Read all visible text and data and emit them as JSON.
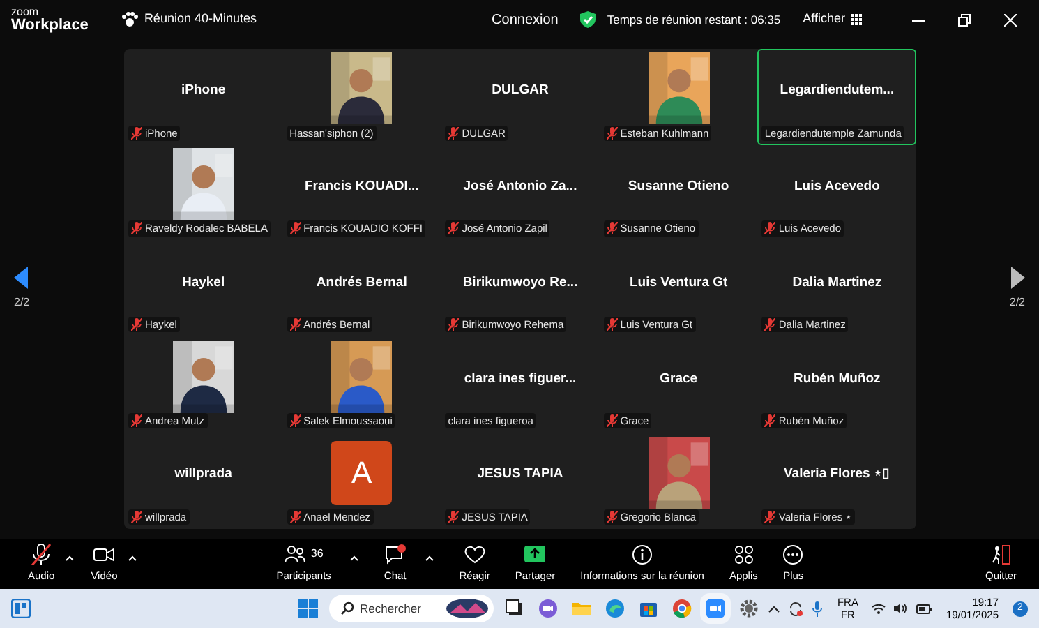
{
  "title_bar": {
    "logo_top": "zoom",
    "logo_bottom": "Workplace",
    "meeting": "Réunion 40-Minutes",
    "signin": "Connexion",
    "timer": "Temps de réunion restant : 06:35",
    "view": "Afficher"
  },
  "pager": {
    "left": "2/2",
    "right": "2/2"
  },
  "tiles": [
    {
      "kind": "name",
      "title": "iPhone",
      "label": "iPhone",
      "muted": true,
      "active": false
    },
    {
      "kind": "video",
      "label": "Hassan'siphon (2)",
      "muted": false,
      "active": false
    },
    {
      "kind": "name",
      "title": "DULGAR",
      "label": "DULGAR",
      "muted": true,
      "active": false
    },
    {
      "kind": "video",
      "label": "Esteban Kuhlmann",
      "muted": true,
      "active": false
    },
    {
      "kind": "name",
      "title": "Legardiendutem...",
      "label": "Legardiendutemple Zamunda",
      "muted": false,
      "active": true
    },
    {
      "kind": "video",
      "label": "Raveldy Rodalec BABELA",
      "muted": true,
      "active": false
    },
    {
      "kind": "name",
      "title": "Francis  KOUADI...",
      "label": "Francis KOUADIO KOFFI",
      "muted": true,
      "active": false
    },
    {
      "kind": "name",
      "title": "José Antonio Za...",
      "label": "José Antonio Zapil",
      "muted": true,
      "active": false
    },
    {
      "kind": "name",
      "title": "Susanne Otieno",
      "label": "Susanne Otieno",
      "muted": true,
      "active": false
    },
    {
      "kind": "name",
      "title": "Luis Acevedo",
      "label": "Luis Acevedo",
      "muted": true,
      "active": false
    },
    {
      "kind": "name",
      "title": "Haykel",
      "label": "Haykel",
      "muted": true,
      "active": false
    },
    {
      "kind": "name",
      "title": "Andrés Bernal",
      "label": "Andrés Bernal",
      "muted": true,
      "active": false
    },
    {
      "kind": "name",
      "title": "Birikumwoyo  Re...",
      "label": "Birikumwoyo Rehema",
      "muted": true,
      "active": false
    },
    {
      "kind": "name",
      "title": "Luis Ventura Gt",
      "label": "Luis Ventura Gt",
      "muted": true,
      "active": false
    },
    {
      "kind": "name",
      "title": "Dalia Martinez",
      "label": "Dalia Martinez",
      "muted": true,
      "active": false
    },
    {
      "kind": "video",
      "label": "Andrea Mutz",
      "muted": true,
      "active": false
    },
    {
      "kind": "video",
      "label": "Salek Elmoussaoui",
      "muted": true,
      "active": false
    },
    {
      "kind": "name",
      "title": "clara ines figuer...",
      "label": "clara ines figueroa",
      "muted": false,
      "active": false
    },
    {
      "kind": "name",
      "title": "Grace",
      "label": "Grace",
      "muted": true,
      "active": false
    },
    {
      "kind": "name",
      "title": "Rubén Muñoz",
      "label": "Rubén Muñoz",
      "muted": true,
      "active": false
    },
    {
      "kind": "name",
      "title": "willprada",
      "label": "willprada",
      "muted": true,
      "active": false
    },
    {
      "kind": "avatar",
      "letter": "A",
      "label": "Anael Mendez",
      "muted": true,
      "active": false
    },
    {
      "kind": "name",
      "title": "JESUS TAPIA",
      "label": "JESUS TAPIA",
      "muted": true,
      "active": false
    },
    {
      "kind": "video",
      "label": "Gregorio Blanca",
      "muted": true,
      "active": false
    },
    {
      "kind": "name",
      "title": "Valeria  Flores  ⋆▯",
      "label": "Valeria Flores ⋆",
      "muted": true,
      "active": false
    }
  ],
  "toolbar": {
    "left": [
      {
        "kind": "audio",
        "label": "Audio"
      },
      {
        "kind": "video",
        "label": "Vidéo"
      }
    ],
    "center": [
      {
        "kind": "participants",
        "label": "Participants",
        "count": "36"
      },
      {
        "kind": "chat",
        "label": "Chat"
      },
      {
        "kind": "react",
        "label": "Réagir"
      },
      {
        "kind": "share",
        "label": "Partager"
      },
      {
        "kind": "info",
        "label": "Informations sur la réunion"
      },
      {
        "kind": "apps",
        "label": "Applis"
      },
      {
        "kind": "more",
        "label": "Plus"
      }
    ],
    "quit": "Quitter"
  },
  "taskbar": {
    "search_placeholder": "Rechercher",
    "lang_top": "FRA",
    "lang_bottom": "FR",
    "time": "19:17",
    "date": "19/01/2025",
    "notifications": "2"
  }
}
